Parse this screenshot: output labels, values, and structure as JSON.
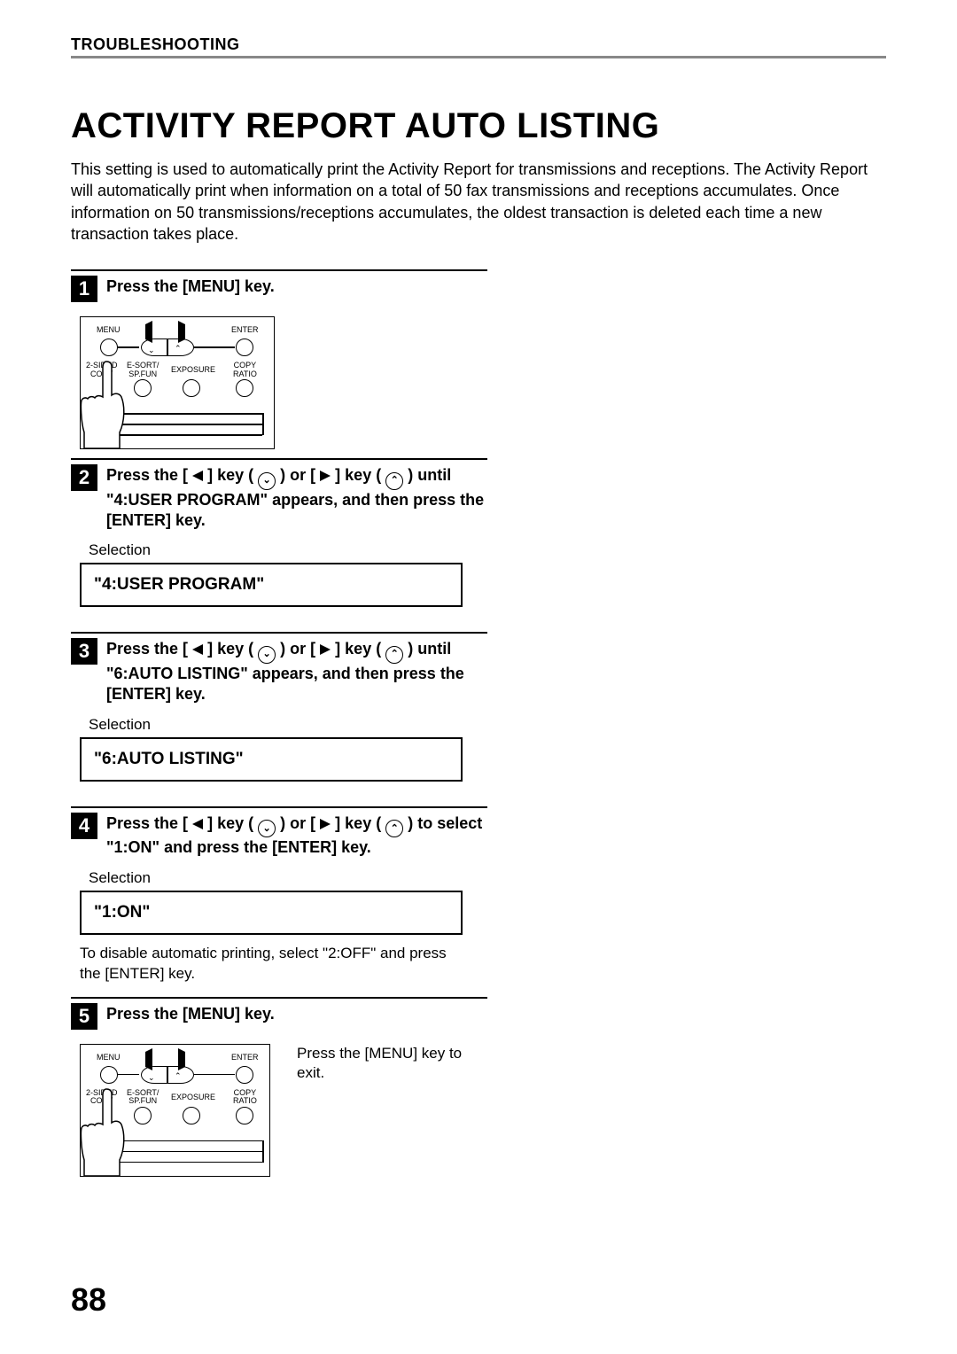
{
  "header": {
    "section": "TROUBLESHOOTING"
  },
  "title": "ACTIVITY REPORT AUTO LISTING",
  "intro": "This setting is used to automatically print the Activity Report for transmissions and receptions. The Activity Report will automatically print when information on a total of 50 fax transmissions and receptions accumulates. Once information on 50 transmissions/receptions accumulates, the oldest transaction is deleted each time a new transaction takes place.",
  "panel_labels": {
    "menu": "MENU",
    "enter": "ENTER",
    "two_sided": "2-SIDED\nCOPY",
    "esort": "E-SORT/\nSP.FUN",
    "exposure": "EXPOSURE",
    "copy_ratio": "COPY\nRATIO"
  },
  "steps": {
    "s1": {
      "num": "1",
      "title": "Press the [MENU] key."
    },
    "s2": {
      "num": "2",
      "title_parts": {
        "a": "Press the [",
        "b": "] key (",
        "c": ") or [",
        "d": "] key (",
        "e": ") until \"4:USER PROGRAM\" appears, and then press the [ENTER] key."
      },
      "selection_label": "Selection",
      "selection_value": "\"4:USER PROGRAM\""
    },
    "s3": {
      "num": "3",
      "title_parts": {
        "a": "Press the [",
        "b": "] key (",
        "c": ") or [",
        "d": "] key (",
        "e": ") until \"6:AUTO LISTING\" appears, and then press the [ENTER] key."
      },
      "selection_label": "Selection",
      "selection_value": "\"6:AUTO LISTING\""
    },
    "s4": {
      "num": "4",
      "title_parts": {
        "a": "Press the [",
        "b": "] key (",
        "c": ") or [",
        "d": "] key (",
        "e": ") to select \"1:ON\" and press the [ENTER] key."
      },
      "selection_label": "Selection",
      "selection_value": "\"1:ON\"",
      "note": "To disable automatic printing, select \"2:OFF\" and press the [ENTER] key."
    },
    "s5": {
      "num": "5",
      "title": "Press the [MENU] key.",
      "side_note": "Press the [MENU] key to exit."
    }
  },
  "page_number": "88"
}
